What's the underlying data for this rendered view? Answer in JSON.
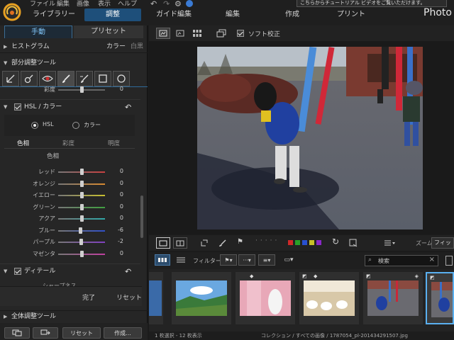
{
  "menu": {
    "file": "ファイル",
    "edit": "編集",
    "image": "画像",
    "view": "表示",
    "help": "ヘルプ"
  },
  "tip_banner": "こちらからチュートリアル ビデオをご覧いただけます。",
  "mode_tabs": {
    "library": "ライブラリー",
    "adjust": "調整",
    "guide_edit": "ガイド編集",
    "edit": "編集",
    "create": "作成",
    "print": "プリント"
  },
  "brand": "Photo",
  "sub_tabs": {
    "manual": "手動",
    "preset": "プリセット"
  },
  "histogram": {
    "label": "ヒストグラム",
    "color": "カラー",
    "mono": "白黒"
  },
  "partial_tools": {
    "label": "部分調整ツール"
  },
  "saturation": {
    "label": "彩度",
    "value": "0",
    "position": 0.5
  },
  "hsl": {
    "label": "HSL / カラー",
    "radio_hsl": "HSL",
    "radio_color": "カラー",
    "tabs": [
      "色相",
      "彩度",
      "明度"
    ],
    "sublabel": "色相",
    "sliders": [
      {
        "name": "レッド",
        "value": "0",
        "position": 0.5,
        "color": "#c84040"
      },
      {
        "name": "オレンジ",
        "value": "0",
        "position": 0.5,
        "color": "#d88a30"
      },
      {
        "name": "イエロー",
        "value": "0",
        "position": 0.5,
        "color": "#c8c030"
      },
      {
        "name": "グリーン",
        "value": "0",
        "position": 0.5,
        "color": "#40a040"
      },
      {
        "name": "アクア",
        "value": "0",
        "position": 0.5,
        "color": "#30a8a8"
      },
      {
        "name": "ブルー",
        "value": "-6",
        "position": 0.47,
        "color": "#3050c8"
      },
      {
        "name": "パープル",
        "value": "-2",
        "position": 0.49,
        "color": "#8040c0"
      },
      {
        "name": "マゼンタ",
        "value": "0",
        "position": 0.5,
        "color": "#c040a0"
      }
    ]
  },
  "detail": {
    "label": "ディテール",
    "partial_text": "シャープネス"
  },
  "panel_buttons": {
    "done": "完了",
    "reset": "リセット"
  },
  "global_tools": {
    "label": "全体調整ツール"
  },
  "bottom_buttons": {
    "reset": "リセット",
    "create": "作成..."
  },
  "viewbar": {
    "soft_proof": "ソフト校正"
  },
  "film_controls": {
    "zoom_label": "ズーム:",
    "zoom_value": "フィット"
  },
  "color_labels": [
    "#d02828",
    "#28a028",
    "#2850d0",
    "#c8c028",
    "#8a28c8"
  ],
  "filter": {
    "label": "フィルター:",
    "search_placeholder": "検索"
  },
  "status": {
    "selection": "1 枚選択 - 12 枚表示",
    "path": "コレクション / すべての画像 / 1787054_pl-201434291507.jpg"
  }
}
